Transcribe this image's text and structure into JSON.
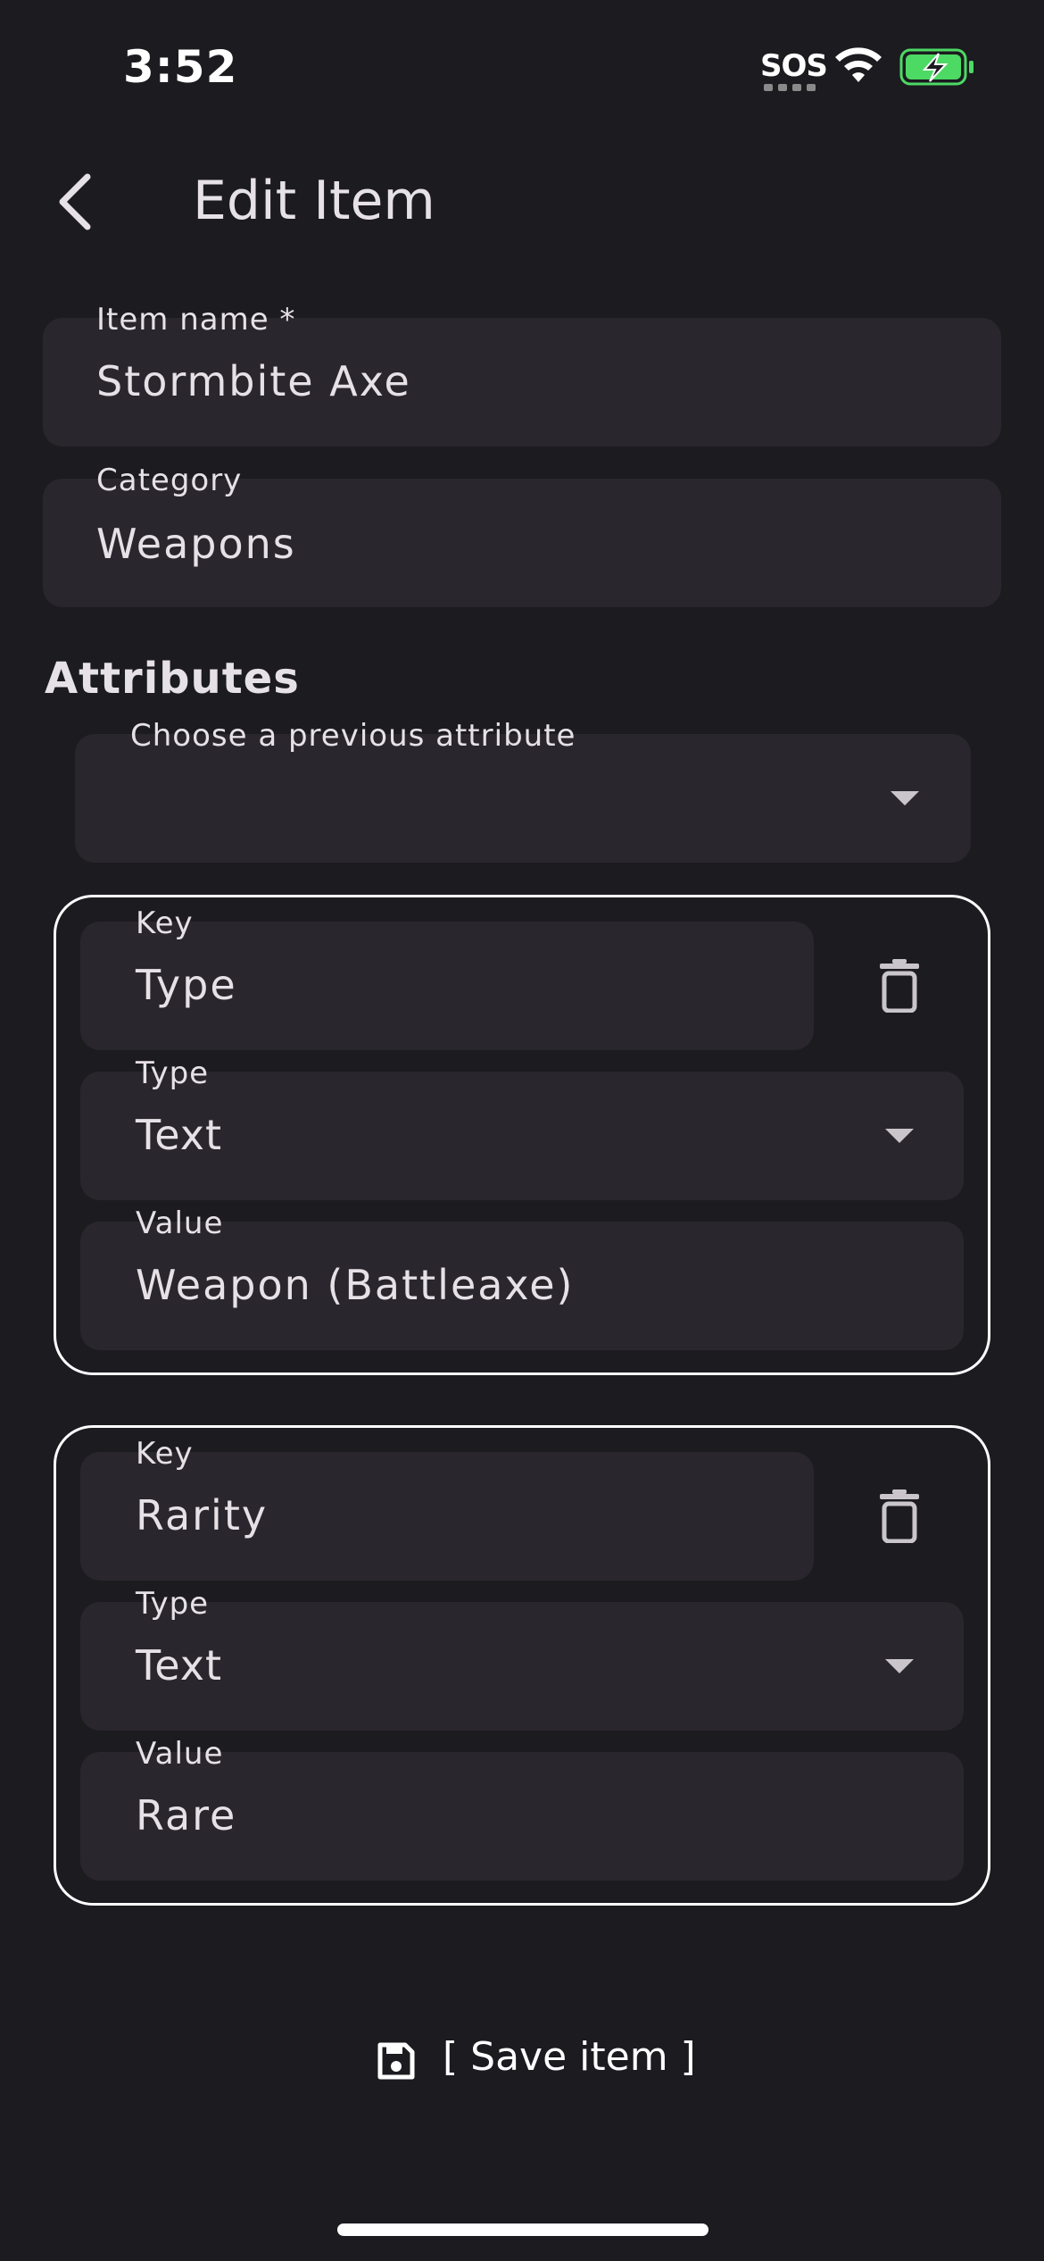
{
  "status_bar": {
    "time": "3:52",
    "sos": "SOS"
  },
  "app_bar": {
    "title": "Edit Item"
  },
  "fields": {
    "item_name": {
      "label": "Item name *",
      "value": "Stormbite Axe"
    },
    "category": {
      "label": "Category",
      "value": "Weapons"
    }
  },
  "attributes": {
    "section_title": "Attributes",
    "chooser": {
      "label": "Choose a previous attribute",
      "value": ""
    },
    "items": [
      {
        "key_label": "Key",
        "key_value": "Type",
        "type_label": "Type",
        "type_value": "Text",
        "value_label": "Value",
        "value_value": "Weapon (Battleaxe)"
      },
      {
        "key_label": "Key",
        "key_value": "Rarity",
        "type_label": "Type",
        "type_value": "Text",
        "value_label": "Value",
        "value_value": "Rare"
      }
    ]
  },
  "save": {
    "label": "[ Save item ]"
  },
  "icons": [
    "back-arrow-icon",
    "trash-icon",
    "dropdown-caret-icon",
    "save-icon",
    "wifi-icon",
    "battery-charging-icon"
  ],
  "colors": {
    "background": "#1c1b20",
    "field": "#29272d",
    "text": "#e6e1e6",
    "battery": "#4cd964"
  }
}
